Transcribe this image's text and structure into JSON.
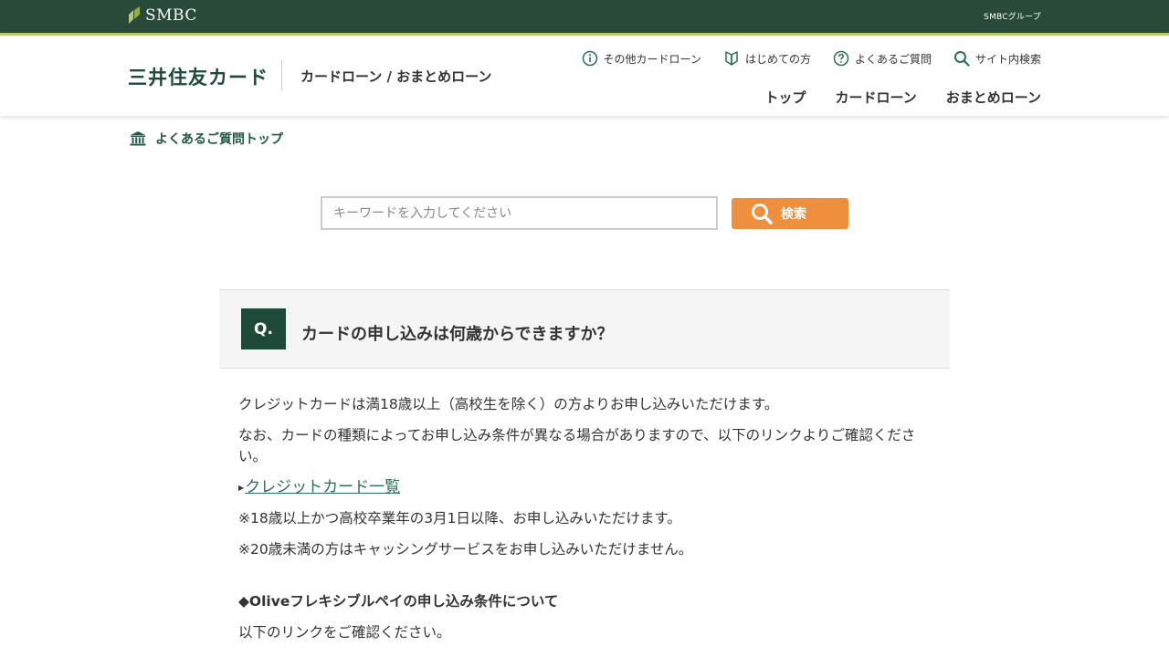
{
  "topbar": {
    "logo_text": "SMBC",
    "group_text": "SMBCグループ"
  },
  "header": {
    "brand": "三井住友カード",
    "subtitle": "カードローン / おまとめローン",
    "util_nav": [
      {
        "label": "その他カードローン",
        "icon": "info-icon"
      },
      {
        "label": "はじめての方",
        "icon": "beginner-mark-icon"
      },
      {
        "label": "よくあるご質問",
        "icon": "question-icon"
      },
      {
        "label": "サイト内検索",
        "icon": "search-icon"
      }
    ],
    "main_nav": [
      "トップ",
      "カードローン",
      "おまとめローン"
    ]
  },
  "breadcrumb": {
    "label": "よくあるご質問トップ",
    "icon": "bank-icon"
  },
  "search": {
    "placeholder": "キーワードを入力してください",
    "value": "",
    "button_label": "検索"
  },
  "question": {
    "badge": "Q.",
    "title": "カードの申し込みは何歳からできますか？"
  },
  "answer": {
    "p1": "クレジットカードは満18歳以上（高校生を除く）の方よりお申し込みいただけます。",
    "p2": "なお、カードの種類によってお申し込み条件が異なる場合がありますので、以下のリンクよりご確認ください。",
    "link_label": "クレジットカード一覧",
    "note1": "※18歳以上かつ高校卒業年の3月1日以降、お申し込みいただけます。",
    "note2": "※20歳未満の方はキャッシングサービスをお申し込みいただけません。",
    "subhead": "◆Oliveフレキシブルペイの申し込み条件について",
    "p3": "以下のリンクをご確認ください。"
  },
  "colors": {
    "topbar": "#2a4a39",
    "accent_line": "#b8c96a",
    "brand_green": "#1e4a3a",
    "search_button": "#ed8f3d",
    "link": "#2b6e5a"
  }
}
